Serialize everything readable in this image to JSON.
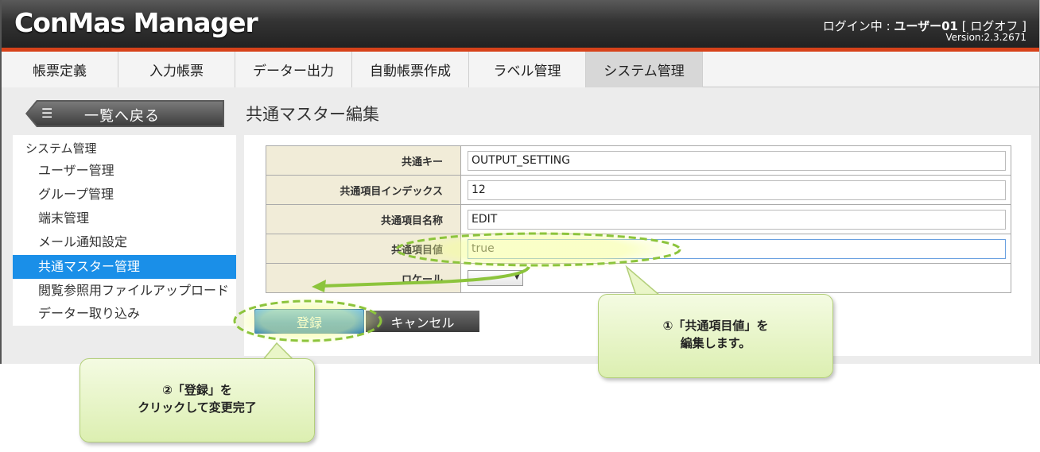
{
  "header": {
    "logo": "ConMas Manager",
    "login_prefix": "ログイン中 : ",
    "user": "ユーザー01",
    "logoff": "[ ログオフ ]",
    "version": "Version:2.3.2671",
    "accent_color": "#d7421a"
  },
  "nav": {
    "tabs": [
      {
        "label": "帳票定義"
      },
      {
        "label": "入力帳票"
      },
      {
        "label": "データー出力"
      },
      {
        "label": "自動帳票作成"
      },
      {
        "label": "ラベル管理"
      },
      {
        "label": "システム管理",
        "active": true
      }
    ]
  },
  "back_button": {
    "label": "一覧へ戻る",
    "icon": "list-icon"
  },
  "page_title": "共通マスター編集",
  "sidebar": {
    "heading": "システム管理",
    "items": [
      {
        "label": "ユーザー管理"
      },
      {
        "label": "グループ管理"
      },
      {
        "label": "端末管理"
      },
      {
        "label": "メール通知設定"
      },
      {
        "label": "共通マスター管理",
        "active": true
      },
      {
        "label": "閲覧参照用ファイルアップロード"
      },
      {
        "label": "データー取り込み"
      }
    ],
    "active_color": "#1a8fe8"
  },
  "form": {
    "rows": [
      {
        "label": "共通キー",
        "value": "OUTPUT_SETTING"
      },
      {
        "label": "共通項目インデックス",
        "value": "12"
      },
      {
        "label": "共通項目名称",
        "value": "EDIT"
      },
      {
        "label": "共通項目値",
        "value": "true"
      },
      {
        "label": "ロケール",
        "value": ""
      }
    ]
  },
  "buttons": {
    "save": "登録",
    "cancel": "キャンセル"
  },
  "callouts": {
    "step1_line1": "①「共通項目値」を",
    "step1_line2": "編集します。",
    "step2_line1": "②「登録」を",
    "step2_line2": "クリックして変更完了"
  }
}
